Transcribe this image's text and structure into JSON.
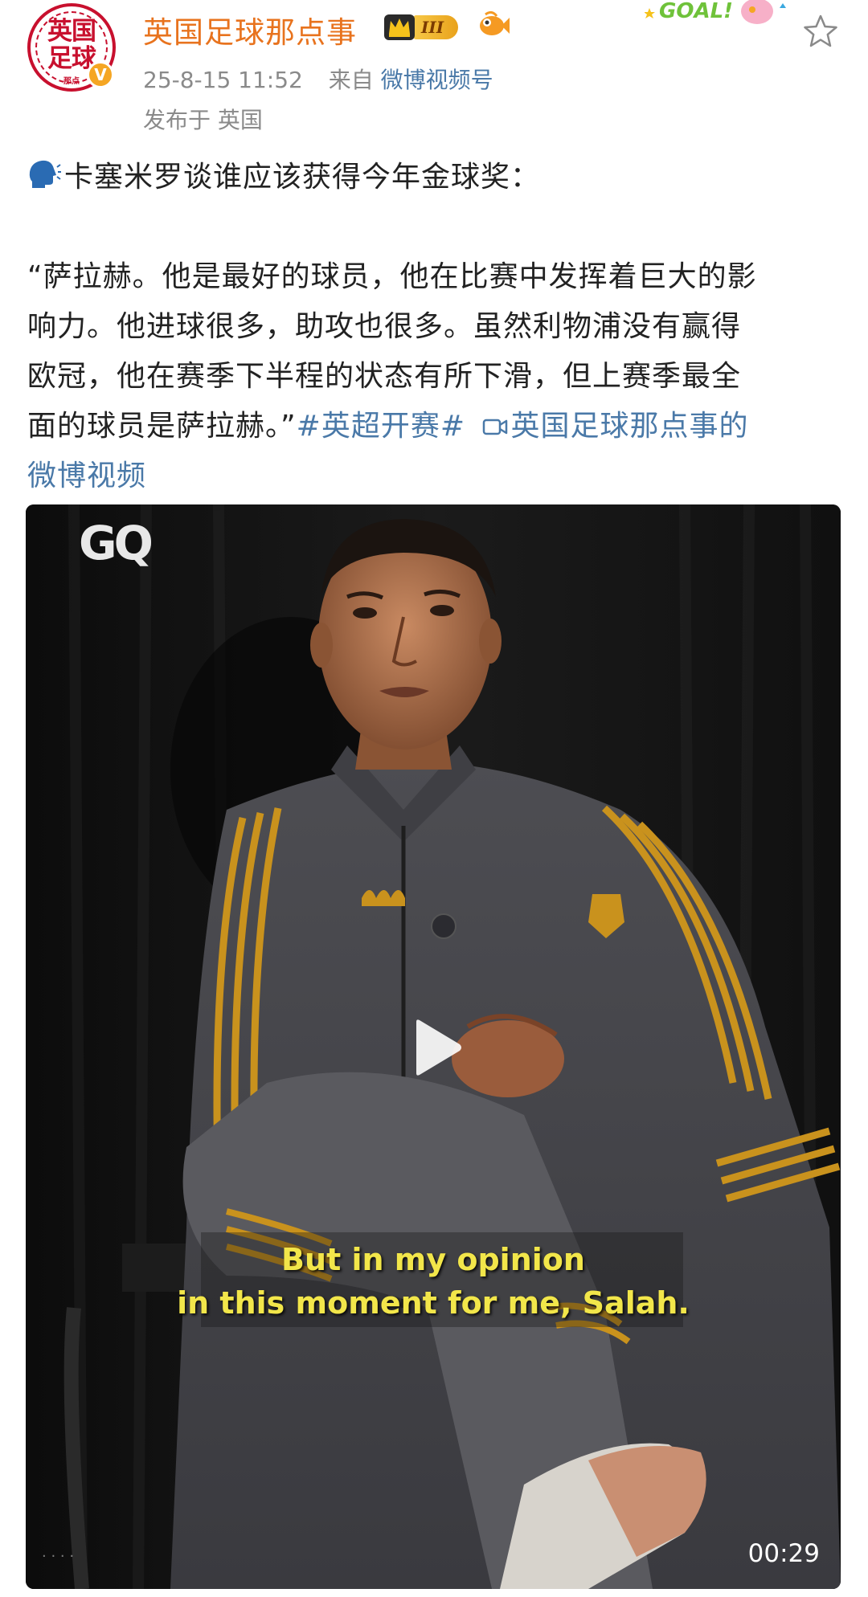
{
  "header": {
    "username": "英国足球那点事",
    "level_label": "III",
    "timestamp": "25-8-15 11:52",
    "source_prefix": "来自",
    "source_name": "微博视频号",
    "location_line": "发布于 英国",
    "avatar_text": "英国足球",
    "avatar_sub": "那点",
    "verified_mark": "V",
    "sticker_text": "GOAL!"
  },
  "post": {
    "line1": "卡塞米罗谈谁应该获得今年金球奖：",
    "line2": "“萨拉赫。他是最好的球员，他在比赛中发挥着巨大的影",
    "line3": "响力。他进球很多，助攻也很多。虽然利物浦没有赢得",
    "line4": "欧冠，他在赛季下半程的状态有所下滑，但上赛季最全",
    "line5_text": "面的球员是萨拉赫。”",
    "hashtag": "#英超开赛#",
    "video_link_part1": "英国足球那点事的",
    "video_link_part2": "微博视频"
  },
  "video": {
    "brand": "GQ",
    "subtitle_line1": "But in my opinion",
    "subtitle_line2": "in this moment for me, Salah.",
    "duration": "00:29"
  },
  "colors": {
    "username": "#e8731e",
    "link": "#4a79a8",
    "meta": "#8a8a8a",
    "subtitle": "#f2e64a"
  },
  "icons": [
    "speaking-head-icon",
    "crown-icon",
    "fish-icon",
    "star-icon",
    "video-link-icon",
    "play-icon"
  ]
}
